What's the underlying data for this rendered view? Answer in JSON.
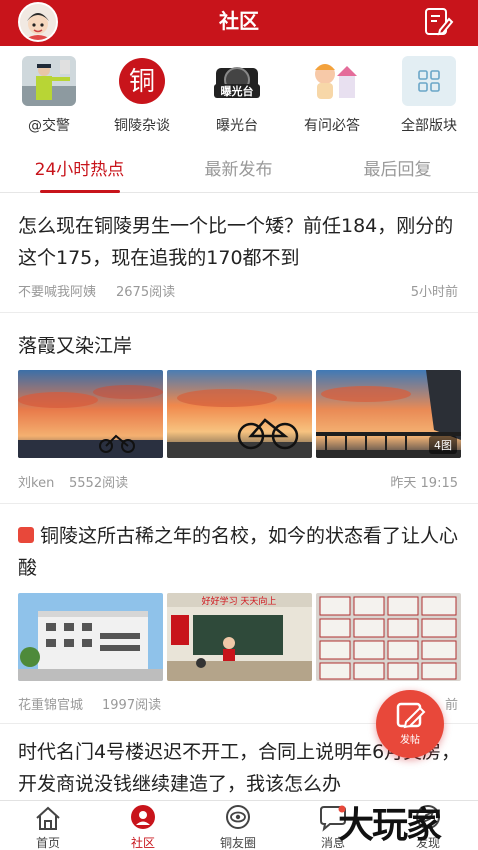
{
  "header": {
    "title": "社区"
  },
  "boards": [
    {
      "label": "@交警"
    },
    {
      "label": "铜陵杂谈",
      "emblem": "铜"
    },
    {
      "label": "曝光台",
      "emblem": "曝光台"
    },
    {
      "label": "有问必答"
    },
    {
      "label": "全部版块"
    }
  ],
  "tabs": [
    {
      "label": "24小时热点",
      "active": true
    },
    {
      "label": "最新发布",
      "active": false
    },
    {
      "label": "最后回复",
      "active": false
    }
  ],
  "posts": [
    {
      "title": "怎么现在铜陵男生一个比一个矮？前任184，刚分的这个175，现在追我的170都不到",
      "author": "不要喊我阿姨",
      "reads": "2675阅读",
      "time": "5小时前"
    },
    {
      "title": "落霞又染江岸",
      "author": "刘ken",
      "reads": "5552阅读",
      "time": "昨天 19:15",
      "image_count": "4图"
    },
    {
      "title": "铜陵这所古稀之年的名校，如今的状态看了让人心酸",
      "author": "花重锦官城",
      "reads": "1997阅读",
      "time": "前",
      "banner_text": "好好学习  天天向上"
    },
    {
      "title": "时代名门4号楼迟迟不开工，合同上说明年6月交房，开发商说没钱继续建造了，我该怎么办"
    }
  ],
  "fab": {
    "label": "发帖"
  },
  "bottom_nav": [
    {
      "label": "首页",
      "active": false
    },
    {
      "label": "社区",
      "active": true
    },
    {
      "label": "铜友圈",
      "active": false
    },
    {
      "label": "消息",
      "active": false
    },
    {
      "label": "发现",
      "active": false
    }
  ],
  "watermark": "大玩家",
  "colors": {
    "brand": "#c8141b",
    "accent": "#e8483a",
    "muted": "#999999"
  },
  "icons": [
    "user-avatar-icon",
    "edit-post-icon",
    "grid-icon",
    "home-icon",
    "community-icon",
    "circle-eye-icon",
    "message-icon",
    "discover-icon",
    "pencil-icon"
  ]
}
